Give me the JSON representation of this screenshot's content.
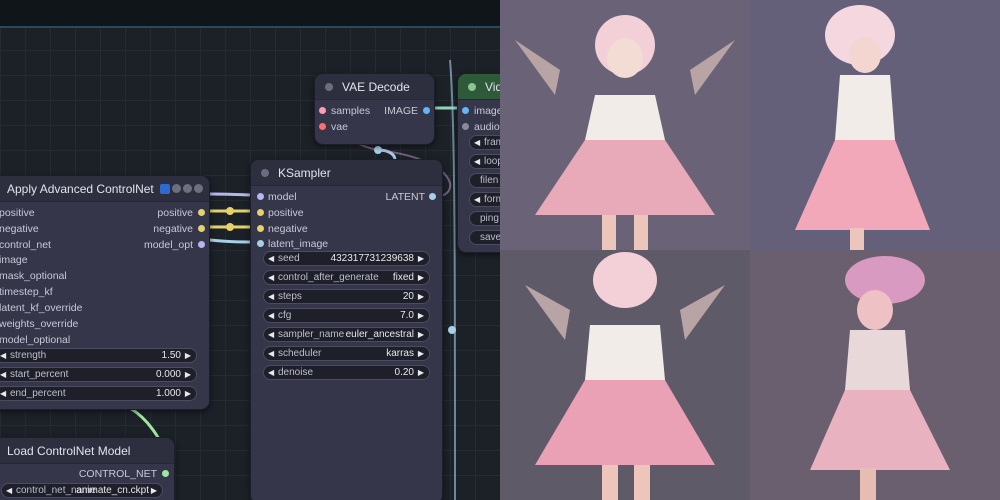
{
  "nodes": {
    "vae_decode": {
      "title": "VAE Decode",
      "inputs": [
        "samples",
        "vae"
      ],
      "output": "IMAGE"
    },
    "video_combine": {
      "title": "Vide",
      "inputs": [
        "images",
        "audio"
      ],
      "widgets": [
        "fram",
        "loop",
        "filen",
        "form",
        "ping",
        "save"
      ]
    },
    "ksampler": {
      "title": "KSampler",
      "inputs": [
        "model",
        "positive",
        "negative",
        "latent_image"
      ],
      "output": "LATENT",
      "widgets": [
        {
          "label": "seed",
          "value": "432317731239638"
        },
        {
          "label": "control_after_generate",
          "value": "fixed"
        },
        {
          "label": "steps",
          "value": "20"
        },
        {
          "label": "cfg",
          "value": "7.0"
        },
        {
          "label": "sampler_name",
          "value": "euler_ancestral"
        },
        {
          "label": "scheduler",
          "value": "karras"
        },
        {
          "label": "denoise",
          "value": "0.20"
        }
      ]
    },
    "apply_controlnet": {
      "title": "Apply Advanced ControlNet",
      "inputs": [
        "positive",
        "negative",
        "control_net",
        "image",
        "mask_optional",
        "timestep_kf",
        "latent_kf_override",
        "weights_override",
        "model_optional"
      ],
      "outputs": [
        "positive",
        "negative",
        "model_opt"
      ],
      "widgets": [
        {
          "label": "strength",
          "value": "1.50"
        },
        {
          "label": "start_percent",
          "value": "0.000"
        },
        {
          "label": "end_percent",
          "value": "1.000"
        }
      ]
    },
    "load_controlnet": {
      "title": "Load ControlNet Model",
      "output": "CONTROL_NET",
      "widget": {
        "label": "control_net_name",
        "value": "animate_cn.ckpt"
      }
    }
  },
  "socket_colors": {
    "model": "#b4b6f0",
    "conditioning": "#e6d26a",
    "latent": "#ff9cb8",
    "image": "#64b5f6",
    "vae": "#ff6e6e",
    "control_net": "#a0e6a0"
  },
  "gallery": {
    "frames": [
      "frame-1",
      "frame-2",
      "frame-3",
      "frame-4"
    ],
    "palette": {
      "background": "#6a6276",
      "skirt": "#e8a9b8",
      "shirt": "#f1ece8",
      "hair": "#f3cfd8"
    }
  }
}
